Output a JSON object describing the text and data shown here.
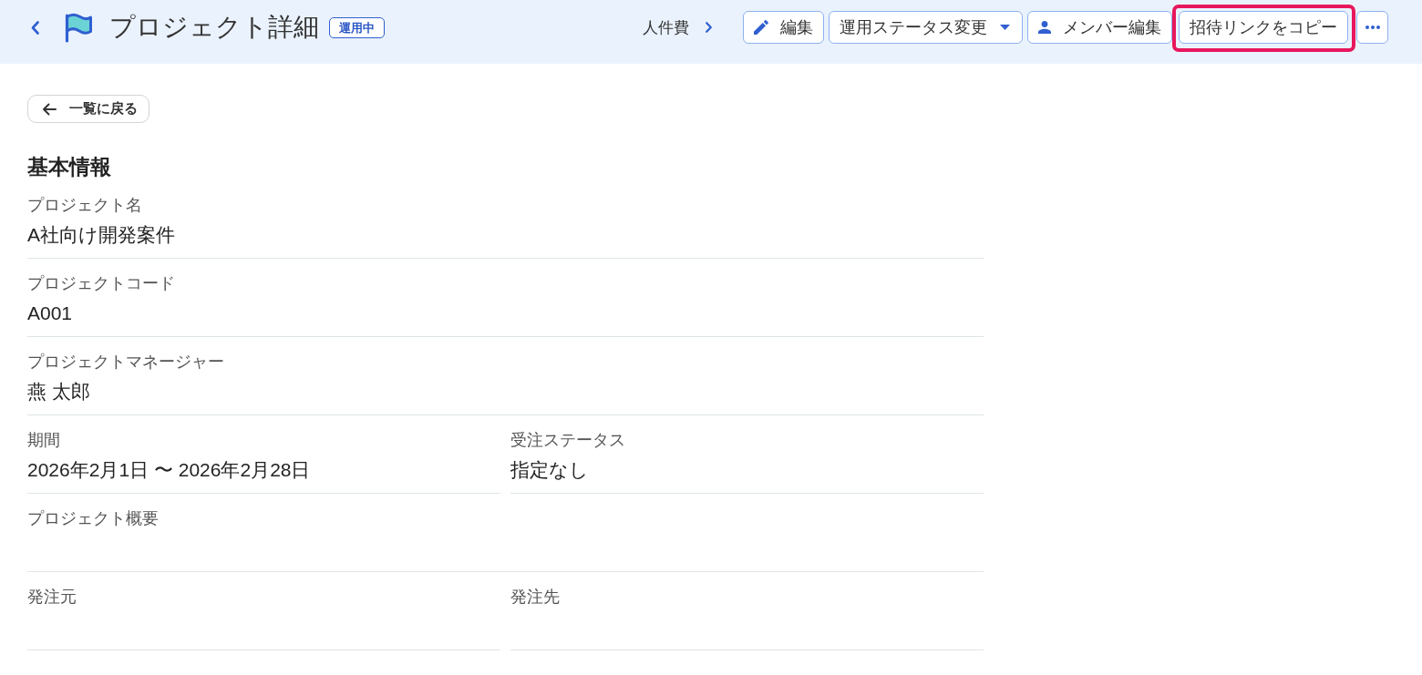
{
  "header": {
    "title": "プロジェクト詳細",
    "status_badge": "運用中",
    "breadcrumb": "人件費",
    "actions": [
      {
        "kind": "edit",
        "label": "編集",
        "highlighted": false
      },
      {
        "kind": "menu",
        "label": "運用ステータス変更",
        "highlighted": false
      },
      {
        "kind": "members",
        "label": "メンバー編集",
        "highlighted": false
      },
      {
        "kind": "text",
        "label": "招待リンクをコピー",
        "highlighted": true
      },
      {
        "kind": "more",
        "highlighted": false
      }
    ]
  },
  "back_link": {
    "label": "一覧に戻る"
  },
  "section": {
    "title": "基本情報",
    "fields": [
      {
        "kind": "full",
        "label": "プロジェクト名",
        "value": "A社向け開発案件"
      },
      {
        "kind": "full",
        "label": "プロジェクトコード",
        "value": "A001"
      },
      {
        "kind": "full",
        "label": "プロジェクトマネージャー",
        "value": "燕 太郎"
      },
      {
        "kind": "half",
        "label": "期間",
        "value": "2026年2月1日 〜 2026年2月28日"
      },
      {
        "kind": "half",
        "label": "受注ステータス",
        "value": "指定なし"
      },
      {
        "kind": "full",
        "label": "プロジェクト概要"
      },
      {
        "kind": "half",
        "label": "発注元"
      },
      {
        "kind": "half",
        "label": "発注先"
      }
    ]
  }
}
